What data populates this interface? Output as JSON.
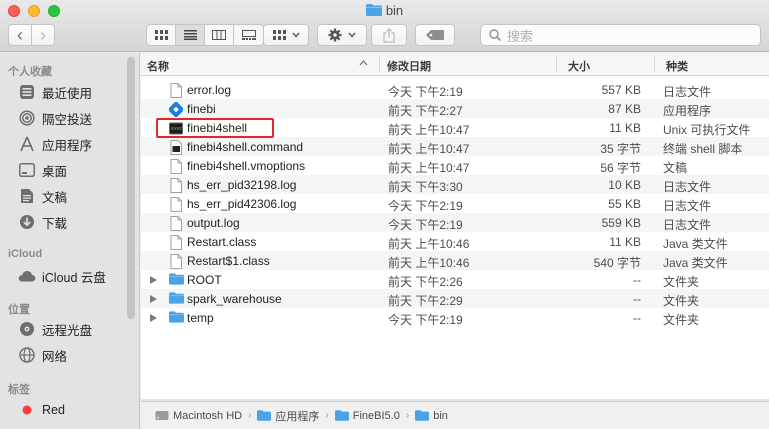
{
  "window": {
    "title": "bin"
  },
  "toolbar": {
    "back_label": "‹",
    "forward_label": "›",
    "search_placeholder": "搜索"
  },
  "sidebar": {
    "sections": [
      {
        "header": "个人收藏",
        "items": [
          {
            "label": "最近使用",
            "icon": "recents-icon"
          },
          {
            "label": "隔空投送",
            "icon": "airdrop-icon"
          },
          {
            "label": "应用程序",
            "icon": "applications-icon"
          },
          {
            "label": "桌面",
            "icon": "desktop-icon"
          },
          {
            "label": "文稿",
            "icon": "documents-icon"
          },
          {
            "label": "下载",
            "icon": "downloads-icon"
          }
        ]
      },
      {
        "header": "iCloud",
        "items": [
          {
            "label": "iCloud 云盘",
            "icon": "icloud-icon"
          }
        ]
      },
      {
        "header": "位置",
        "items": [
          {
            "label": "远程光盘",
            "icon": "remote-disc-icon"
          },
          {
            "label": "网络",
            "icon": "network-icon"
          }
        ]
      },
      {
        "header": "标签",
        "items": [
          {
            "label": "Red",
            "icon": "red-tag-icon"
          }
        ]
      }
    ]
  },
  "columns": {
    "name": "名称",
    "date": "修改日期",
    "size": "大小",
    "kind": "种类"
  },
  "files": [
    {
      "name": "error.log",
      "date": "今天 下午2:19",
      "size": "557 KB",
      "kind": "日志文件",
      "type": "doc"
    },
    {
      "name": "finebi",
      "date": "前天 下午2:27",
      "size": "87 KB",
      "kind": "应用程序",
      "type": "app"
    },
    {
      "name": "finebi4shell",
      "date": "前天 上午10:47",
      "size": "11 KB",
      "kind": "Unix 可执行文件",
      "type": "exec"
    },
    {
      "name": "finebi4shell.command",
      "date": "前天 上午10:47",
      "size": "35 字节",
      "kind": "终端 shell 脚本",
      "type": "script"
    },
    {
      "name": "finebi4shell.vmoptions",
      "date": "前天 上午10:47",
      "size": "56 字节",
      "kind": "文稿",
      "type": "doc"
    },
    {
      "name": "hs_err_pid32198.log",
      "date": "前天 下午3:30",
      "size": "10 KB",
      "kind": "日志文件",
      "type": "doc"
    },
    {
      "name": "hs_err_pid42306.log",
      "date": "今天 下午2:19",
      "size": "55 KB",
      "kind": "日志文件",
      "type": "doc"
    },
    {
      "name": "output.log",
      "date": "今天 下午2:19",
      "size": "559 KB",
      "kind": "日志文件",
      "type": "doc"
    },
    {
      "name": "Restart.class",
      "date": "前天 上午10:46",
      "size": "11 KB",
      "kind": "Java 类文件",
      "type": "doc"
    },
    {
      "name": "Restart$1.class",
      "date": "前天 上午10:46",
      "size": "540 字节",
      "kind": "Java 类文件",
      "type": "doc"
    },
    {
      "name": "ROOT",
      "date": "前天 下午2:26",
      "size": "--",
      "kind": "文件夹",
      "type": "folder"
    },
    {
      "name": "spark_warehouse",
      "date": "前天 下午2:29",
      "size": "--",
      "kind": "文件夹",
      "type": "folder"
    },
    {
      "name": "temp",
      "date": "今天 下午2:19",
      "size": "--",
      "kind": "文件夹",
      "type": "folder"
    }
  ],
  "pathbar": [
    "Macintosh HD",
    "应用程序",
    "FineBI5.0",
    "bin"
  ],
  "colors": {
    "folder": "#4ba3e6",
    "highlight": "#e0262b",
    "tag_red": "#fc3d39"
  }
}
